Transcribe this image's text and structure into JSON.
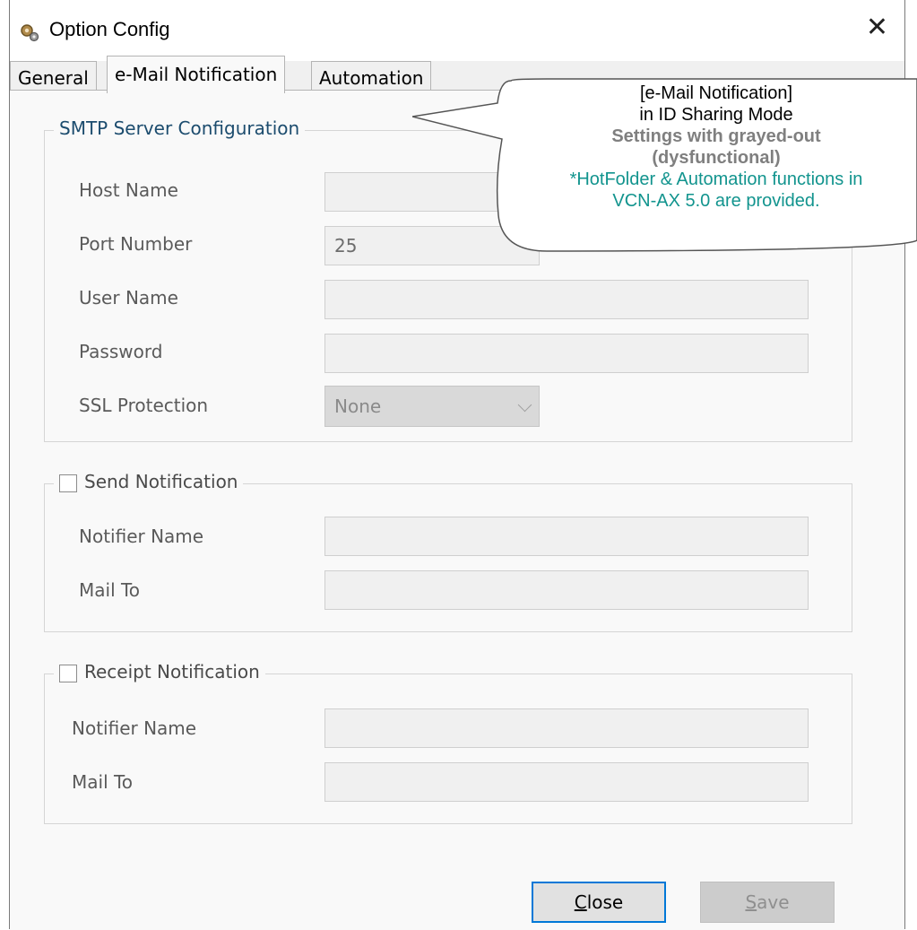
{
  "window": {
    "title": "Option Config",
    "close_symbol": "✕"
  },
  "tabs": [
    {
      "label": "General",
      "active": false
    },
    {
      "label": "e-Mail Notification",
      "active": true
    },
    {
      "label": "Automation",
      "active": false
    }
  ],
  "smtp": {
    "legend": "SMTP Server Configuration",
    "host_label": "Host Name",
    "host_value": "",
    "port_label": "Port Number",
    "port_value": "25",
    "user_label": "User Name",
    "user_value": "",
    "password_label": "Password",
    "password_value": "",
    "ssl_label": "SSL Protection",
    "ssl_value": "None"
  },
  "send_notification": {
    "legend": "Send Notification",
    "checked": false,
    "notifier_label": "Notifier Name",
    "mailto_label": "Mail To"
  },
  "receipt_notification": {
    "legend": "Receipt Notification",
    "checked": false,
    "notifier_label": "Notifier Name",
    "mailto_label": "Mail To"
  },
  "buttons": {
    "close_first": "C",
    "close_rest": "lose",
    "save_first": "S",
    "save_rest": "ave"
  },
  "callout": {
    "line1": "[e-Mail Notification]",
    "line2": "in ID Sharing Mode",
    "line3": "Settings with grayed-out",
    "line4": "(dysfunctional)",
    "line5": "*HotFolder & Automation functions in",
    "line6": "VCN-AX 5.0 are provided."
  },
  "colors": {
    "accent": "#0078d7",
    "callout_teal": "#12948e",
    "callout_gray": "#7f7f7f"
  }
}
